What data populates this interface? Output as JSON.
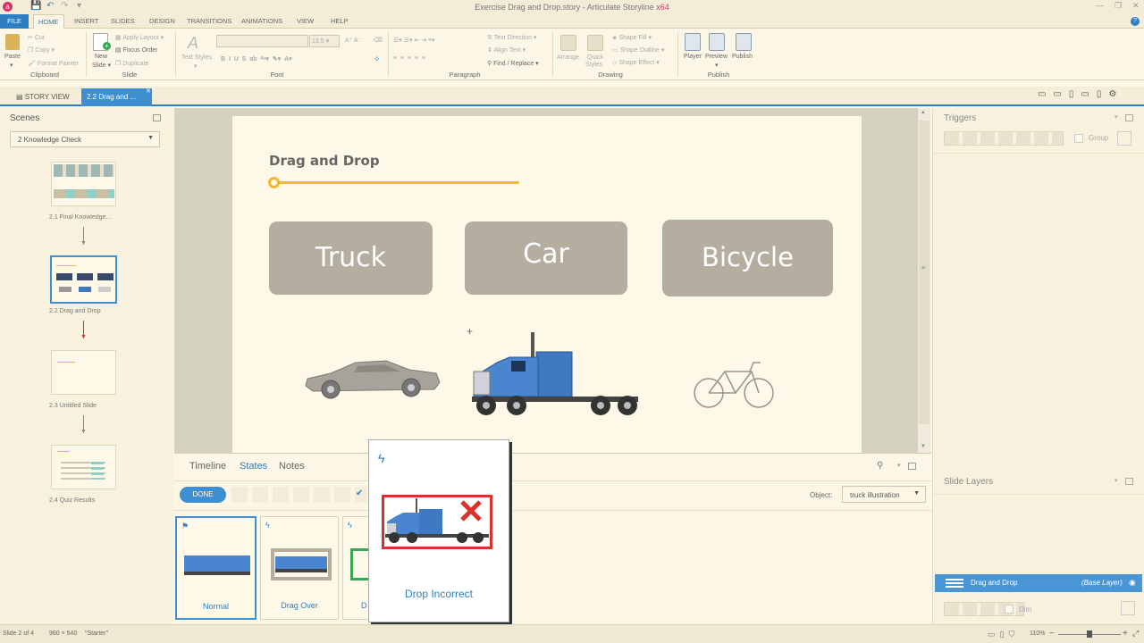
{
  "window": {
    "title": "Exercise Drag and Drop.story - Articulate Storyline",
    "edition": "x64"
  },
  "ribbon_tabs": [
    "FILE",
    "HOME",
    "INSERT",
    "SLIDES",
    "DESIGN",
    "TRANSITIONS",
    "ANIMATIONS",
    "VIEW",
    "HELP"
  ],
  "clipboard": {
    "paste": "Paste",
    "cut": "Cut",
    "copy": "Copy",
    "format_painter": "Format Painter",
    "label": "Clipboard"
  },
  "slide_group": {
    "new_slide": "New",
    "new_slide2": "Slide",
    "apply_layout": "Apply Layout",
    "focus_order": "Focus Order",
    "duplicate": "Duplicate",
    "label": "Slide"
  },
  "font_group": {
    "text_styles": "Text Styles",
    "font_size": "13.5",
    "label": "Font"
  },
  "paragraph_group": {
    "text_direction": "Text Direction",
    "align_text": "Align Text",
    "find_replace": "Find / Replace",
    "label": "Paragraph"
  },
  "drawing_group": {
    "arrange": "Arrange",
    "quick": "Quick",
    "styles": "Styles",
    "shape_fill": "Shape Fill",
    "shape_outline": "Shape Outline",
    "shape_effect": "Shape Effect",
    "label": "Drawing"
  },
  "publish_group": {
    "player": "Player",
    "preview": "Preview",
    "publish": "Publish",
    "label": "Publish"
  },
  "doc_tabs": {
    "story_view": "STORY VIEW",
    "current": "2.2 Drag and ..."
  },
  "scenes": {
    "title": "Scenes",
    "selected": "2 Knowledge Check",
    "slides": [
      {
        "caption": "2.1 Final Knowledge..."
      },
      {
        "caption": "2.2 Drag and Drop"
      },
      {
        "caption": "2.3 Untitled Slide"
      },
      {
        "caption": "2.4 Quiz Results"
      }
    ]
  },
  "slide": {
    "title": "Drag and Drop",
    "cards": [
      "Truck",
      "Car",
      "Bicycle"
    ],
    "cursor": "+"
  },
  "bottom": {
    "tabs": [
      "Timeline",
      "States",
      "Notes"
    ],
    "active_tab": "States",
    "done": "DONE",
    "object_label": "Object:",
    "object_value": "truck illustration",
    "states": [
      "Normal",
      "Drag Over",
      "D"
    ]
  },
  "popup": {
    "label": "Drop Incorrect"
  },
  "triggers": {
    "title": "Triggers",
    "group": "Group"
  },
  "layers": {
    "title": "Slide Layers",
    "base_name": "Drag and Drop",
    "base_tag": "(Base Layer)",
    "dim": "Dim"
  },
  "status": {
    "slide": "Slide 2 of 4",
    "size": "960 × 540",
    "theme": "\"Starter\"",
    "zoom": "110%"
  },
  "colors": {
    "accent": "#2e7fc1",
    "progress": "#f2b632",
    "card": "#b5aea0",
    "truck": "#3f79c2",
    "wrong": "#d9322d"
  }
}
